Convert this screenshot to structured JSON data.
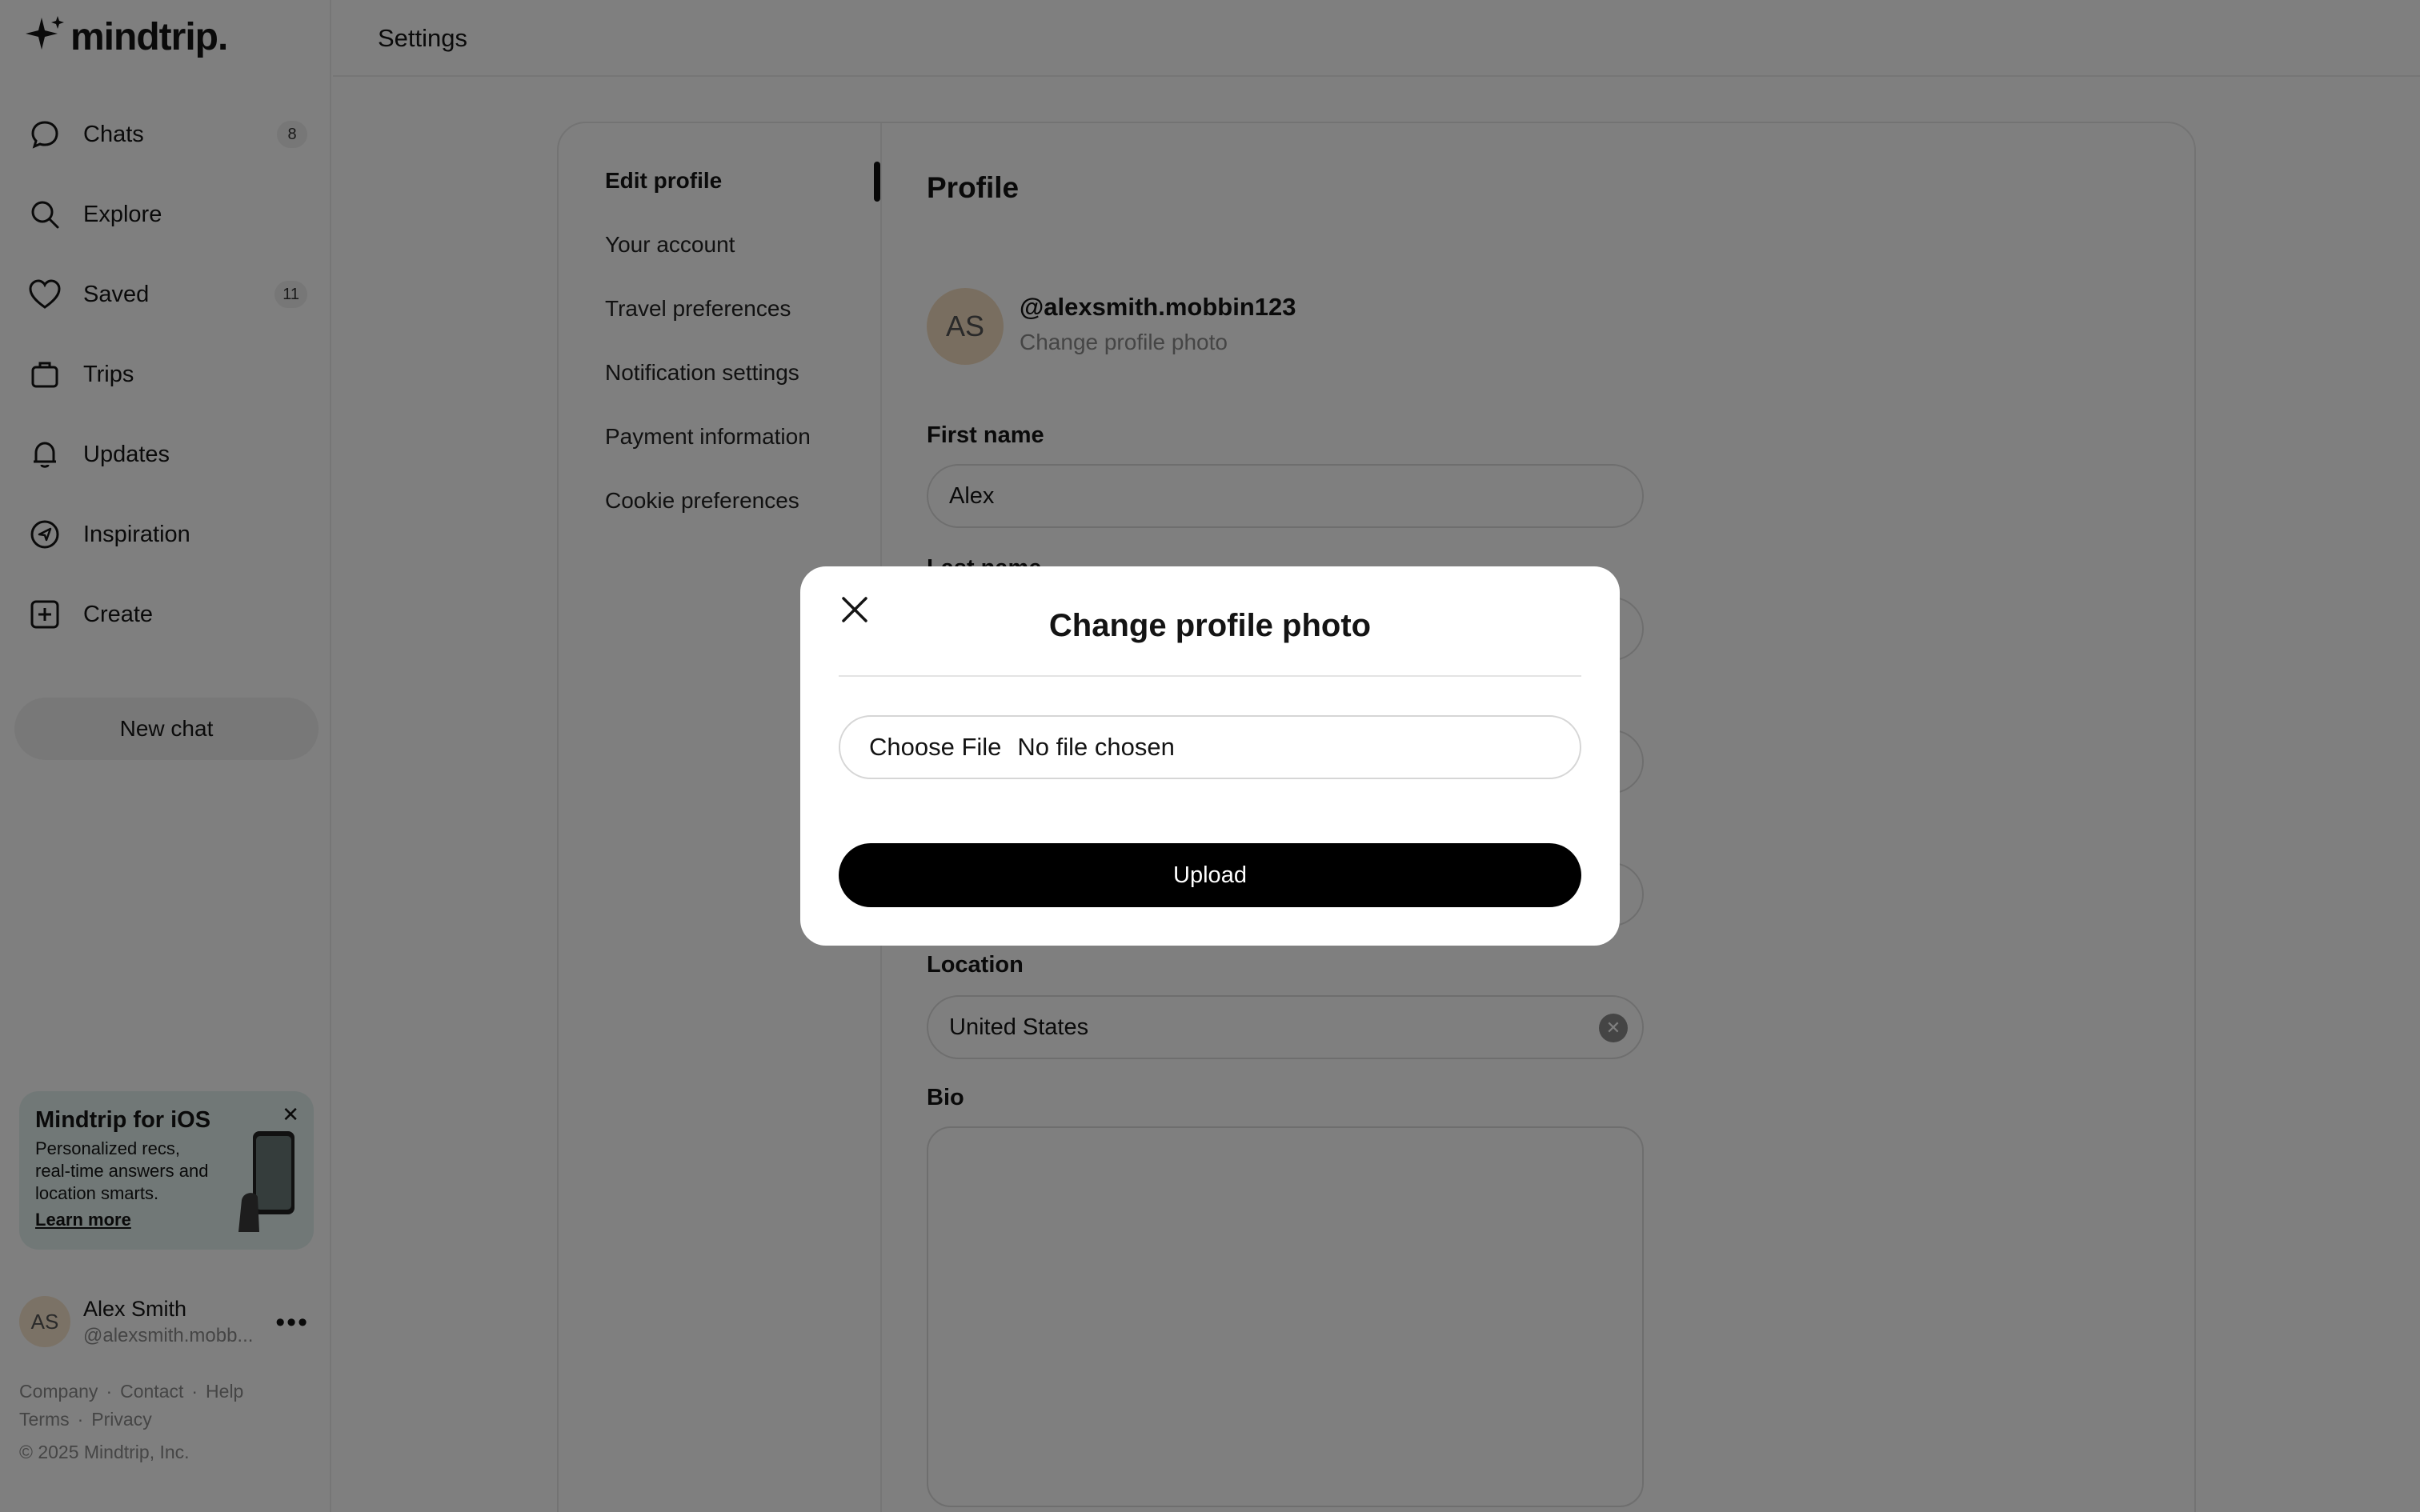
{
  "app": {
    "logo_text": "mindtrip.",
    "page_title": "Settings"
  },
  "sidebar": {
    "nav": [
      {
        "label": "Chats",
        "badge": "8",
        "icon": "chat-bubble-icon"
      },
      {
        "label": "Explore",
        "icon": "search-icon"
      },
      {
        "label": "Saved",
        "badge": "11",
        "icon": "heart-icon"
      },
      {
        "label": "Trips",
        "icon": "suitcase-icon"
      },
      {
        "label": "Updates",
        "icon": "bell-icon"
      },
      {
        "label": "Inspiration",
        "icon": "compass-icon"
      },
      {
        "label": "Create",
        "icon": "plus-square-icon"
      }
    ],
    "new_chat_label": "New chat",
    "promo": {
      "title": "Mindtrip for iOS",
      "text": "Personalized recs, real-time answers and location smarts.",
      "link": "Learn more"
    },
    "user": {
      "initials": "AS",
      "name": "Alex Smith",
      "handle": "@alexsmith.mobb..."
    },
    "footer": {
      "links_row1": [
        "Company",
        "Contact",
        "Help"
      ],
      "links_row2": [
        "Terms",
        "Privacy"
      ],
      "copyright": "© 2025 Mindtrip, Inc."
    }
  },
  "settings_nav": {
    "items": [
      "Edit profile",
      "Your account",
      "Travel preferences",
      "Notification settings",
      "Payment information",
      "Cookie preferences"
    ],
    "active": "Edit profile"
  },
  "profile": {
    "title": "Profile",
    "initials": "AS",
    "handle": "@alexsmith.mobbin123",
    "change_photo": "Change profile photo",
    "first_name_label": "First name",
    "first_name_value": "Alex",
    "last_name_label": "Last name",
    "location_label": "Location",
    "location_value": "United States",
    "bio_label": "Bio"
  },
  "modal": {
    "title": "Change profile photo",
    "choose_file": "Choose File",
    "file_status": "No file chosen",
    "upload_label": "Upload"
  },
  "colors": {
    "accent": "#000000",
    "overlay": "rgba(0,0,0,0.5)",
    "promo_bg": "#e3f1ef",
    "avatar_bg": "#f3ddc0"
  }
}
